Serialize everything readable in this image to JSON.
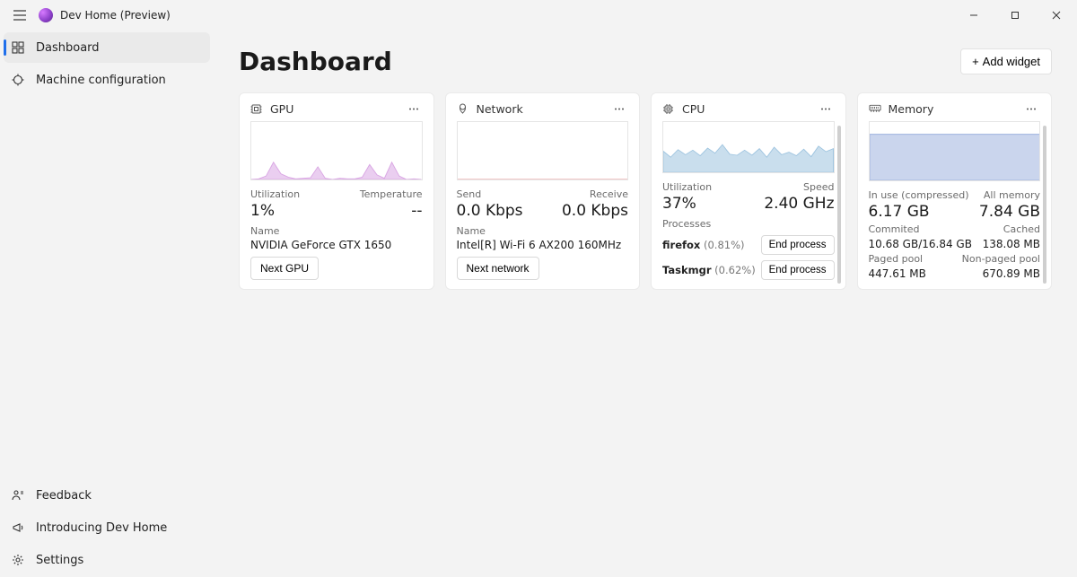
{
  "app": {
    "title": "Dev Home (Preview)"
  },
  "nav": {
    "items": [
      {
        "label": "Dashboard"
      },
      {
        "label": "Machine configuration"
      }
    ],
    "footer": [
      {
        "label": "Feedback"
      },
      {
        "label": "Introducing Dev Home"
      },
      {
        "label": "Settings"
      }
    ]
  },
  "page": {
    "title": "Dashboard",
    "add_widget_label": "Add widget"
  },
  "widgets": {
    "gpu": {
      "title": "GPU",
      "left_label": "Utilization",
      "right_label": "Temperature",
      "left_value": "1%",
      "right_value": "--",
      "name_label": "Name",
      "name_value": "NVIDIA GeForce GTX 1650",
      "next_label": "Next GPU"
    },
    "network": {
      "title": "Network",
      "left_label": "Send",
      "right_label": "Receive",
      "left_value": "0.0 Kbps",
      "right_value": "0.0 Kbps",
      "name_label": "Name",
      "name_value": "Intel[R] Wi-Fi 6 AX200 160MHz",
      "next_label": "Next network"
    },
    "cpu": {
      "title": "CPU",
      "left_label": "Utilization",
      "right_label": "Speed",
      "left_value": "37%",
      "right_value": "2.40 GHz",
      "processes_label": "Processes",
      "procs": [
        {
          "name": "firefox",
          "pct": "(0.81%)",
          "end_label": "End process"
        },
        {
          "name": "Taskmgr",
          "pct": "(0.62%)",
          "end_label": "End process"
        }
      ]
    },
    "memory": {
      "title": "Memory",
      "row1_left_label": "In use (compressed)",
      "row1_right_label": "All memory",
      "row1_left_value": "6.17 GB",
      "row1_right_value": "7.84 GB",
      "row2_left_label": "Commited",
      "row2_right_label": "Cached",
      "row2_left_value": "10.68 GB/16.84 GB",
      "row2_right_value": "138.08 MB",
      "row3_left_label": "Paged pool",
      "row3_right_label": "Non-paged pool",
      "row3_left_value": "447.61 MB",
      "row3_right_value": "670.89 MB"
    }
  },
  "chart_data": [
    {
      "type": "area",
      "title": "GPU utilization",
      "values": [
        0,
        1,
        6,
        30,
        10,
        4,
        1,
        2,
        3,
        22,
        2,
        0,
        2,
        1,
        1,
        4,
        26,
        8,
        2,
        30,
        6,
        0,
        1,
        0
      ],
      "ylim": [
        0,
        100
      ],
      "color": "#d9a6e3"
    },
    {
      "type": "area",
      "title": "Network throughput",
      "values": [
        0.1,
        0.1,
        0.1,
        0.1,
        0.1,
        0.1,
        0.1,
        0.1,
        0.1,
        0.1,
        0.1,
        0.1,
        0.1,
        0.1,
        0.1,
        0.1,
        0.1,
        0.1,
        0.1,
        0.1,
        0.1,
        0.1,
        0.1,
        0.1
      ],
      "ylim": [
        0,
        100
      ],
      "color": "#e99393"
    },
    {
      "type": "area",
      "title": "CPU utilization",
      "values": [
        42,
        30,
        45,
        35,
        44,
        33,
        48,
        38,
        55,
        36,
        34,
        44,
        34,
        47,
        30,
        50,
        35,
        40,
        33,
        46,
        31,
        52,
        41,
        47
      ],
      "ylim": [
        0,
        100
      ],
      "color": "#9cc3df"
    },
    {
      "type": "area",
      "title": "Memory usage",
      "values": [
        79,
        79,
        79,
        79,
        79,
        79,
        79,
        79,
        79,
        79,
        79,
        79,
        79,
        79,
        79,
        79,
        79,
        79,
        79,
        79,
        79,
        79,
        79,
        79
      ],
      "ylim": [
        0,
        100
      ],
      "color": "#9fb3df"
    }
  ]
}
